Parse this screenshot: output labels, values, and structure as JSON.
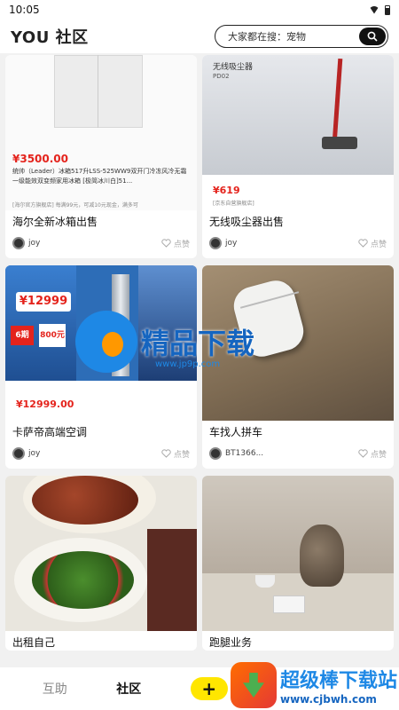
{
  "status_bar": {
    "time": "10:05"
  },
  "header": {
    "logo": "YOU 社区",
    "search_text": "大家都在搜：宠物"
  },
  "cards": [
    {
      "title": "海尔全新冰箱出售",
      "author": "joy",
      "like_label": "点赞",
      "image_price": "¥3500.00",
      "image_desc": "统帅（Leader）冰箱517升LSS-525WW9双开门冷冻风冷无霜一级能效双变频家用冰箱 [极简冰川白]51...",
      "image_sub": "[海尔官方旗舰店] 每满99元，可减10元现金，满多可"
    },
    {
      "title": "无线吸尘器出售",
      "author": "joy",
      "like_label": "点赞",
      "image_heading": "无线吸尘器",
      "image_sub_heading": "PD02",
      "image_price": "¥619",
      "image_sub": "[京东自营旗舰店]"
    },
    {
      "title": "卡萨帝高端空调",
      "author": "joy",
      "like_label": "点赞",
      "image_badge": "¥12999",
      "image_price": "¥12999.00",
      "image_periods": "6期",
      "image_coupon": "800元"
    },
    {
      "title": "车找人拼车",
      "author": "BT1366...",
      "like_label": "点赞"
    },
    {
      "title": "出租自己"
    },
    {
      "title": "跑腿业务"
    }
  ],
  "tabbar": {
    "tabs": [
      "互助",
      "社区"
    ],
    "add_label": "+"
  },
  "watermarks": {
    "center_text": "精品下载",
    "center_url": "www.jp9p.com",
    "corner_title": "超级棒下载站",
    "corner_url": "www.cjbwh.com"
  },
  "colors": {
    "accent_yellow": "#ffe600",
    "price_red": "#e4231c"
  }
}
